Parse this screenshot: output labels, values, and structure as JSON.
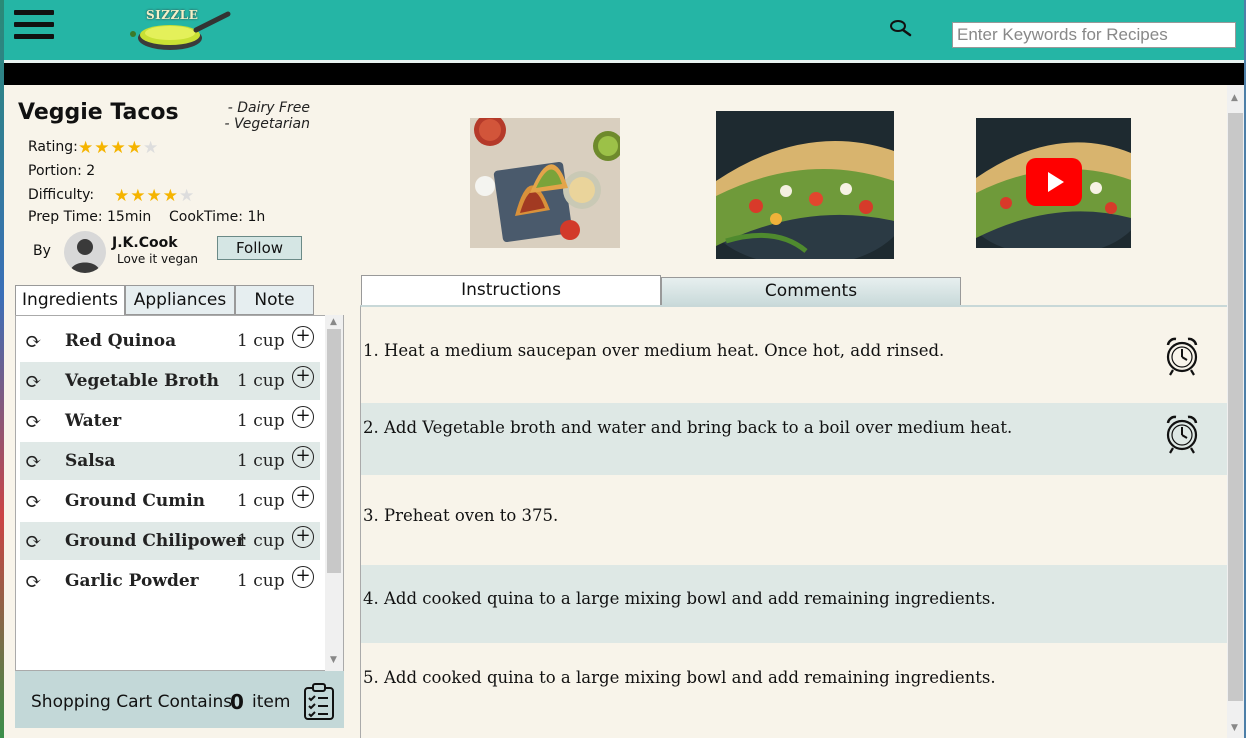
{
  "app": {
    "logo_text": "SIZZLE",
    "search_placeholder": "Enter Keywords for Recipes"
  },
  "recipe": {
    "title": "Veggie Tacos",
    "tags": [
      "- Dairy Free",
      "- Vegetarian"
    ],
    "rating_label": "Rating:",
    "rating_stars": 4,
    "portion": "Portion: 2",
    "difficulty_label": "Difficulty:",
    "difficulty_stars": 4,
    "prep_time": "Prep Time: 15min",
    "cook_time": "CookTime: 1h",
    "by_label": "By",
    "author_name": "J.K.Cook",
    "author_bio": "Love it vegan",
    "follow_label": "Follow"
  },
  "left_tabs": [
    "Ingredients",
    "Appliances",
    "Note"
  ],
  "ingredients": [
    {
      "name": "Red Quinoa",
      "qty": "1 cup"
    },
    {
      "name": "Vegetable Broth",
      "qty": "1 cup"
    },
    {
      "name": "Water",
      "qty": "1 cup"
    },
    {
      "name": "Salsa",
      "qty": "1 cup"
    },
    {
      "name": "Ground Cumin",
      "qty": "1 cup"
    },
    {
      "name": "Ground Chilipower",
      "qty": "1 cup"
    },
    {
      "name": "Garlic Powder",
      "qty": "1 cup"
    }
  ],
  "cart": {
    "label": "Shopping Cart Contains",
    "count": "0",
    "unit": "item"
  },
  "right_tabs": {
    "instructions": "Instructions",
    "comments": "Comments"
  },
  "steps": [
    {
      "text": "1. Heat a medium saucepan over medium heat. Once hot, add rinsed.",
      "timer": true
    },
    {
      "text": "2. Add Vegetable broth and water and bring back to a boil over medium heat.",
      "timer": true
    },
    {
      "text": "3. Preheat oven to 375.",
      "timer": false
    },
    {
      "text": "4. Add cooked quina to a large mixing bowl and add remaining ingredients.",
      "timer": false
    },
    {
      "text": "5. Add cooked quina to a large mixing bowl and add remaining ingredients.",
      "timer": false
    }
  ],
  "colors": {
    "header_teal": "#25b5a5",
    "content_cream": "#f8f4ea",
    "shaded_row": "#e0e9e7",
    "star_gold": "#f5b400",
    "video_red": "#ff0000"
  },
  "icons": [
    "hamburger-menu-icon",
    "search-icon",
    "refresh-icon",
    "add-circle-icon",
    "alarm-clock-icon",
    "clipboard-checklist-icon",
    "play-icon",
    "avatar-icon"
  ]
}
